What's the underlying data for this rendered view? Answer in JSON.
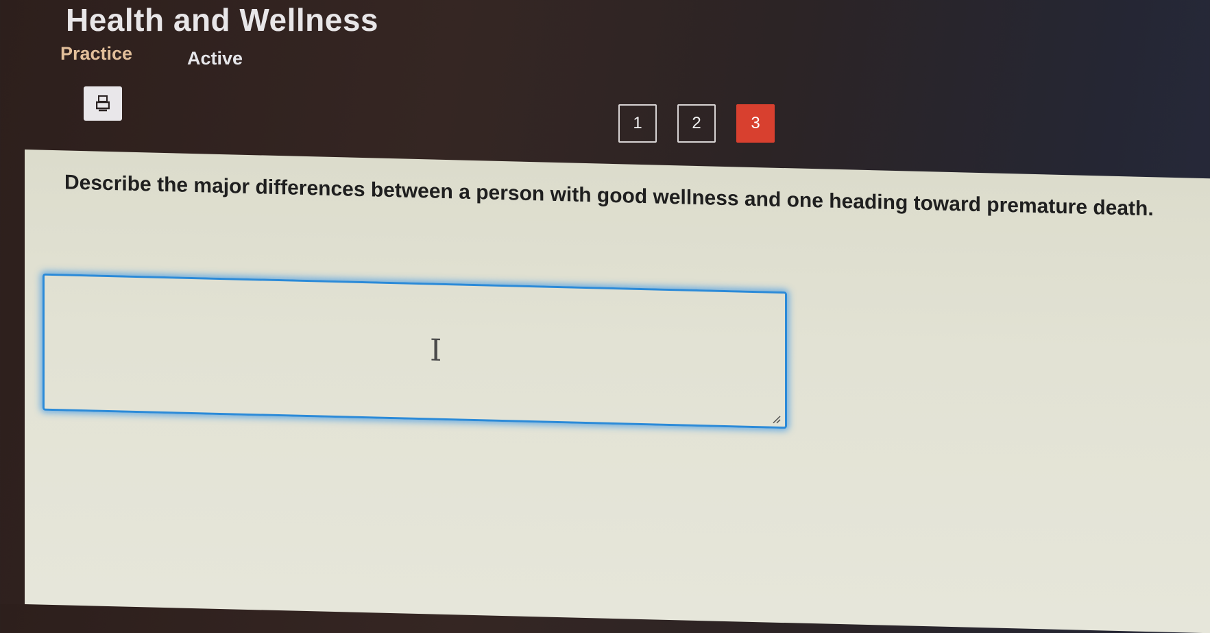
{
  "header": {
    "title": "Health and Wellness",
    "tabs": [
      {
        "label": "Practice"
      },
      {
        "label": "Active"
      }
    ]
  },
  "toolbar": {
    "print_icon": "print-icon"
  },
  "pagination": {
    "pages": [
      "1",
      "2",
      "3"
    ],
    "current": "3",
    "current_color": "#d8402f"
  },
  "question": {
    "text": "Describe the major differences between a person with good wellness and one heading toward premature death."
  },
  "answer": {
    "value": "",
    "focus_color": "#2b8ad8"
  }
}
